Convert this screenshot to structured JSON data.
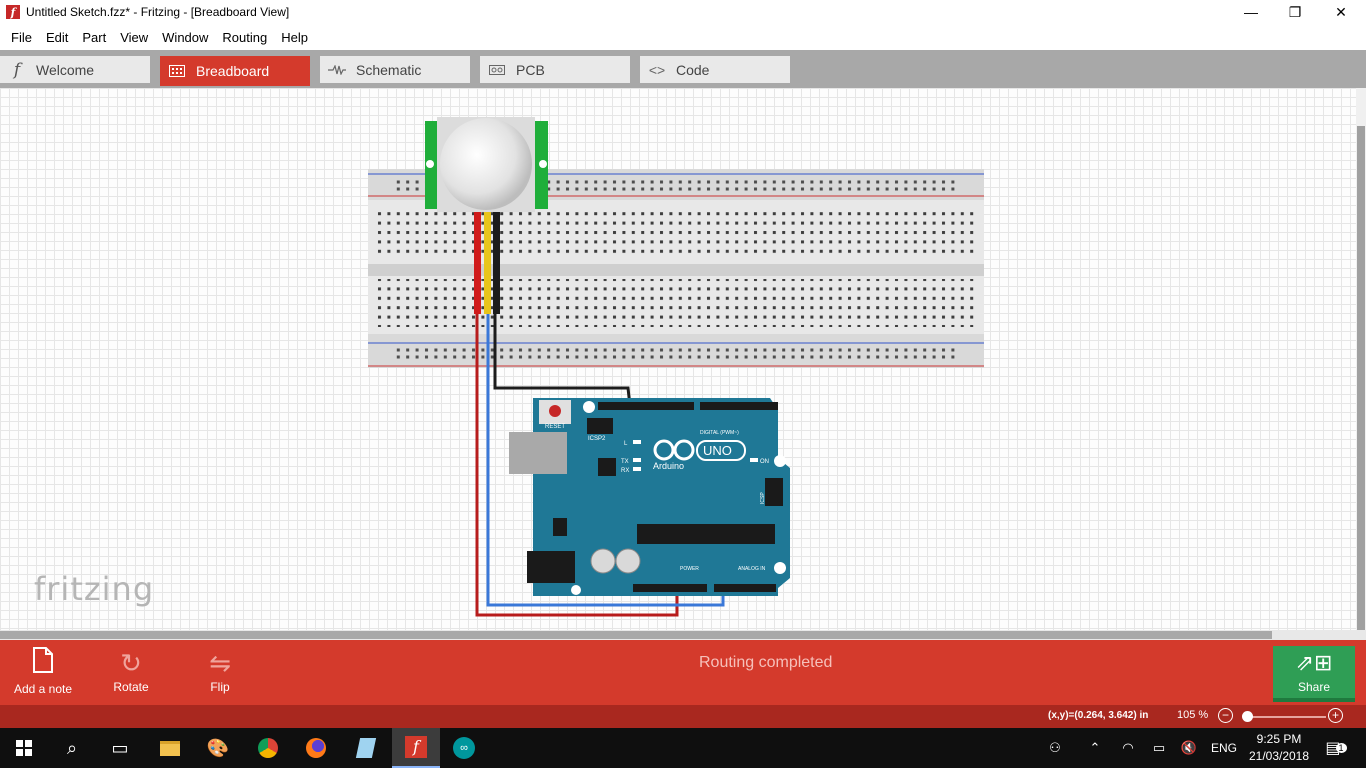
{
  "window": {
    "title": "Untitled Sketch.fzz* - Fritzing - [Breadboard View]",
    "app_icon_glyph": "f",
    "minimize": "—",
    "restore": "❐",
    "close": "✕"
  },
  "menu": [
    "File",
    "Edit",
    "Part",
    "View",
    "Window",
    "Routing",
    "Help"
  ],
  "tabs": [
    {
      "label": "Welcome",
      "icon": "fritzing-f-icon",
      "active": false
    },
    {
      "label": "Breadboard",
      "icon": "breadboard-icon",
      "active": true
    },
    {
      "label": "Schematic",
      "icon": "resistor-icon",
      "active": false
    },
    {
      "label": "PCB",
      "icon": "pcb-icon",
      "active": false
    },
    {
      "label": "Code",
      "icon": "code-icon",
      "active": false
    }
  ],
  "canvas": {
    "watermark": "fritzing",
    "arduino_labels": {
      "reset": "RESET",
      "icsp2": "ICSP2",
      "brand": "Arduino",
      "model": "UNO",
      "digital": "DIGITAL (PWM~)",
      "on": "ON",
      "tx": "TX",
      "rx": "RX",
      "l": "L",
      "icsp": "ICSP",
      "power": "POWER",
      "analog": "ANALOG IN"
    }
  },
  "toolbar": {
    "add_note": "Add a note",
    "rotate": "Rotate",
    "flip": "Flip",
    "status": "Routing completed",
    "share": "Share"
  },
  "statusbar": {
    "coords": "(x,y)=(0.264, 3.642) in",
    "zoom": "105 %",
    "zoom_fraction": 0.05
  },
  "taskbar": {
    "language": "ENG",
    "time": "9:25 PM",
    "date": "21/03/2018",
    "notifications": "1"
  },
  "colors": {
    "accent": "#d43a2c",
    "statusbar": "#a9281f",
    "share": "#2f9e55",
    "arduino": "#1f7896"
  }
}
